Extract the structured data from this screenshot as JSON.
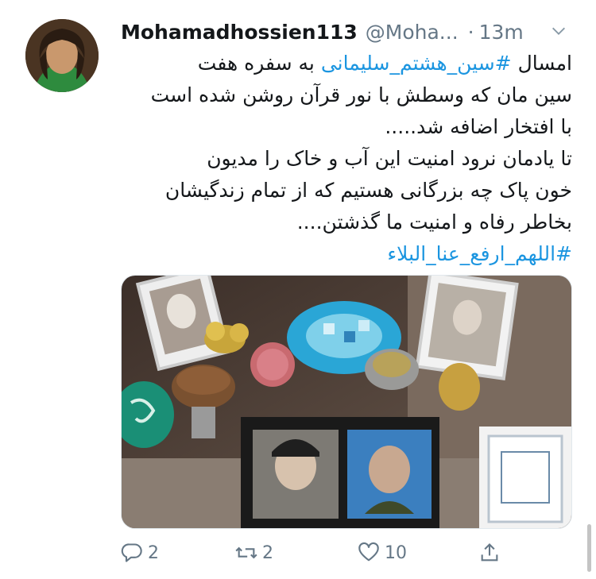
{
  "tweet": {
    "display_name": "Mohamadhossien113",
    "handle": "@Moha...",
    "separator": "·",
    "time": "13m",
    "text_lines": [
      {
        "pre": "امسال ",
        "tag": "#سین_هشتم_سلیمانی",
        "post": " به سفره هفت"
      },
      {
        "text": "سین مان که وسطش با نور قرآن روشن شده است"
      },
      {
        "text": "با افتخار اضافه شد....."
      },
      {
        "text": "تا یادمان نرود امنیت این آب و خاک را مدیون"
      },
      {
        "text": "خون پاک چه بزرگانی هستیم که از تمام زندگیشان"
      },
      {
        "text": "بخاطر رفاه و امنیت ما گذشتن...."
      },
      {
        "tag": "#اللهم_ارفع_عنا_البلاء"
      }
    ]
  },
  "actions": {
    "reply_count": "2",
    "retweet_count": "2",
    "like_count": "10",
    "share_count": ""
  },
  "icons": {
    "avatar": "user-avatar",
    "chevron": "chevron-down-icon",
    "reply": "reply-icon",
    "retweet": "retweet-icon",
    "like": "heart-icon",
    "share": "share-icon"
  },
  "colors": {
    "link": "#1b95e0",
    "muted": "#657786",
    "text": "#14171a"
  }
}
